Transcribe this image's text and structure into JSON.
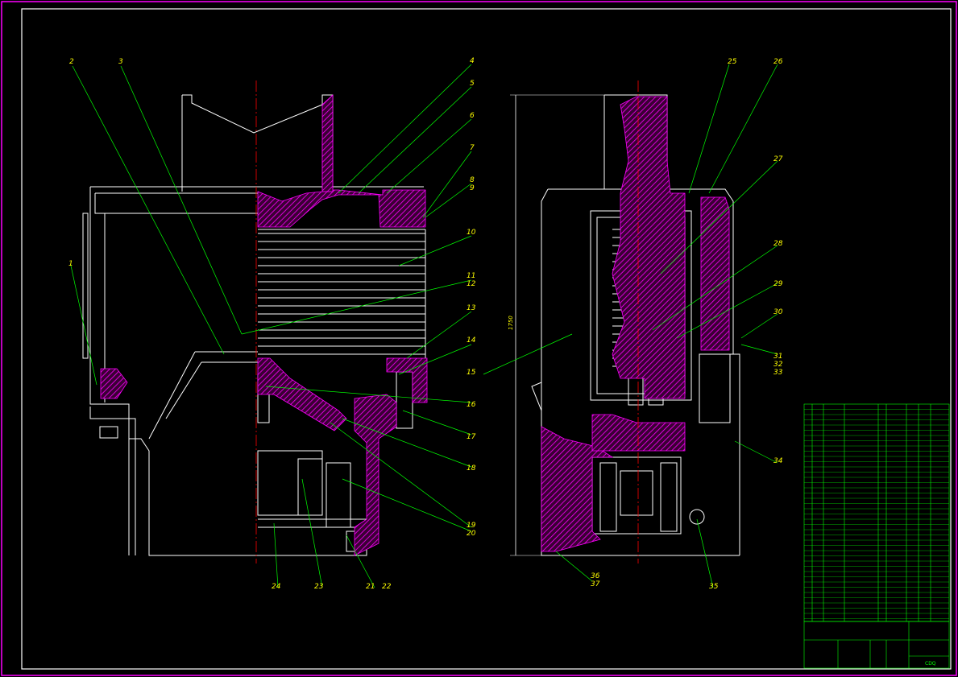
{
  "colors": {
    "background": "#000000",
    "frame": "#ff00ff",
    "outline": "#ffffff",
    "hatch": "#ff00ff",
    "centerline": "#ff0000",
    "leader": "#00ff00",
    "label": "#ffff00"
  },
  "dimension": {
    "height_text": "1750"
  },
  "labels": [
    "1",
    "2",
    "3",
    "4",
    "5",
    "6",
    "7",
    "8",
    "9",
    "10",
    "11",
    "12",
    "13",
    "14",
    "15",
    "16",
    "17",
    "18",
    "19",
    "20",
    "21",
    "22",
    "23",
    "24",
    "25",
    "26",
    "27",
    "28",
    "29",
    "30",
    "31",
    "32",
    "33",
    "34",
    "35",
    "36",
    "37"
  ],
  "title_block": {
    "drawing_code": "CDQ"
  }
}
